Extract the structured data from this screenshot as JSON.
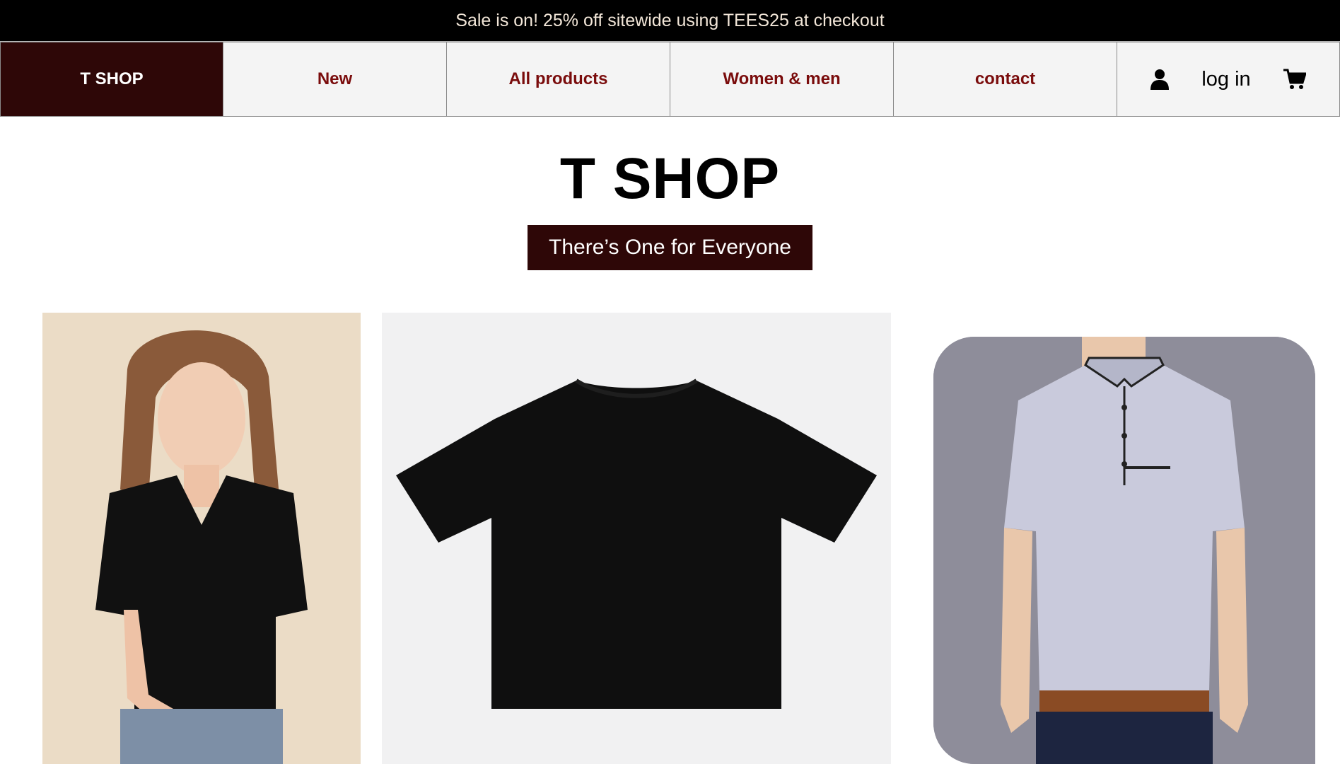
{
  "promo": {
    "text": "Sale is on! 25% off sitewide using TEES25 at checkout"
  },
  "nav": {
    "brand": "T SHOP",
    "items": [
      {
        "label": "New"
      },
      {
        "label": "All products"
      },
      {
        "label": "Women & men"
      },
      {
        "label": "contact"
      }
    ],
    "account": {
      "login_label": "log in",
      "user_icon": "user-icon",
      "cart_icon": "cart-icon"
    }
  },
  "hero": {
    "title": "T SHOP",
    "tagline": "There’s One for Everyone"
  },
  "colors": {
    "brand_dark": "#2e0707",
    "nav_text": "#7a0c0c",
    "nav_bg": "#f4f4f4",
    "promo_bg": "#000000"
  }
}
